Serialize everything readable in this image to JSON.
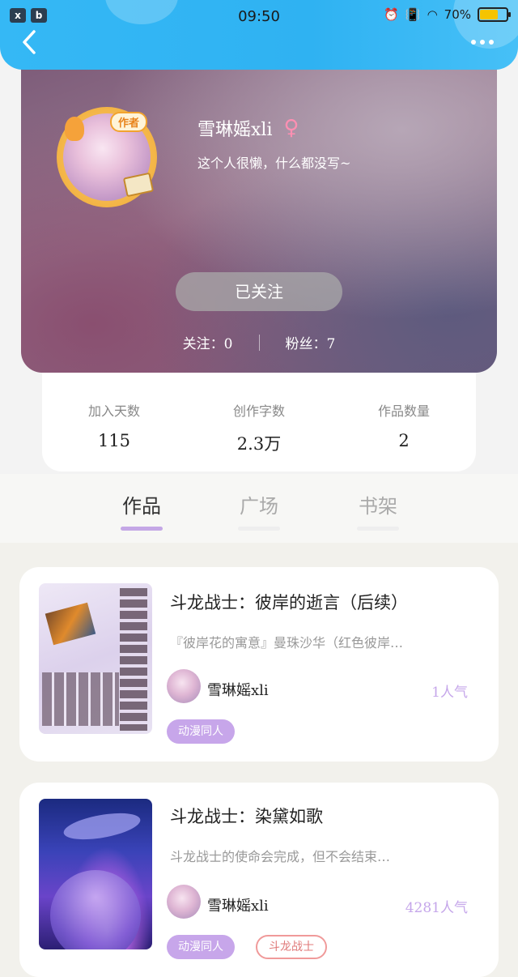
{
  "status_bar": {
    "time": "09:50",
    "battery": "70%",
    "battery_level": 0.7,
    "left_icons": [
      "x",
      "b"
    ]
  },
  "header": {
    "back_icon": "chevron-left-icon",
    "more_icon": "more-dots-icon"
  },
  "profile": {
    "author_badge": "作者",
    "username": "雪琳媱xli",
    "gender_symbol": "♀",
    "bio": "这个人很懒，什么都没写~",
    "follow_button": "已关注",
    "following_label": "关注：",
    "following_count": "0",
    "followers_label": "粉丝：",
    "followers_count": "7"
  },
  "stats": {
    "days_label": "加入天数",
    "days_value": "115",
    "words_label": "创作字数",
    "words_value": "2.3万",
    "works_label": "作品数量",
    "works_value": "2"
  },
  "tabs": [
    {
      "label": "作品",
      "active": true
    },
    {
      "label": "广场",
      "active": false
    },
    {
      "label": "书架",
      "active": false
    }
  ],
  "works": [
    {
      "title": "斗龙战士：彼岸的逝言（后续）",
      "description": "『彼岸花的寓意』曼珠沙华（红色彼岸…",
      "author": "雪琳媱xli",
      "popularity": "1人气",
      "tags": [
        "动漫同人"
      ]
    },
    {
      "title": "斗龙战士：染黛如歌",
      "description": "斗龙战士的使命会完成，但不会结束…",
      "author": "雪琳媱xli",
      "popularity": "4281人气",
      "tags": [
        "动漫同人",
        "斗龙战士"
      ]
    }
  ],
  "colors": {
    "topbar": "#35b8f5",
    "accent_purple": "#c7a6ea",
    "tag_outline": "#f09a9a"
  }
}
